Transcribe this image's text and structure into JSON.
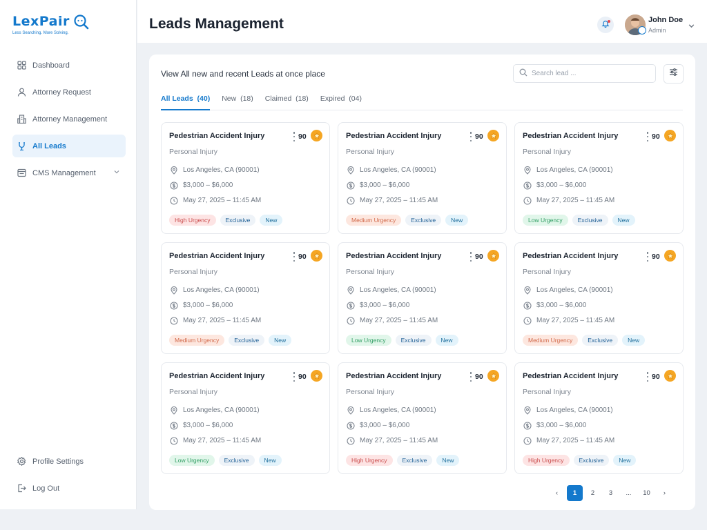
{
  "brand": {
    "name": "LexPair",
    "tagline": "Less Searching. More Solving."
  },
  "sidebar": {
    "items": [
      {
        "label": "Dashboard",
        "icon": "grid-icon"
      },
      {
        "label": "Attorney Request",
        "icon": "user-icon"
      },
      {
        "label": "Attorney Management",
        "icon": "building-icon"
      },
      {
        "label": "All Leads",
        "icon": "leads-icon",
        "active": true
      },
      {
        "label": "CMS Management",
        "icon": "cms-icon"
      }
    ],
    "bottom": [
      {
        "label": "Profile Settings",
        "icon": "gear-icon"
      },
      {
        "label": "Log Out",
        "icon": "logout-icon"
      }
    ]
  },
  "header": {
    "title": "Leads Management",
    "user": {
      "name": "John Doe",
      "role": "Admin"
    }
  },
  "main": {
    "subtitle": "View All new and recent Leads at once place",
    "search_placeholder": "Search lead ...",
    "tabs": [
      {
        "label": "All Leads",
        "count": "(40)"
      },
      {
        "label": "New",
        "count": "(18)"
      },
      {
        "label": "Claimed",
        "count": "(18)"
      },
      {
        "label": "Expired",
        "count": "(04)"
      }
    ]
  },
  "leads": [
    {
      "title": "Pedestrian Accident Injury",
      "score": "90",
      "category": "Personal Injury",
      "location": "Los Angeles, CA (90001)",
      "price": "$3,000 – $6,000",
      "date": "May 27, 2025 – 11:45 AM",
      "urgency": "High Urgency",
      "exclusive": "Exclusive",
      "status": "New"
    },
    {
      "title": "Pedestrian Accident Injury",
      "score": "90",
      "category": "Personal Injury",
      "location": "Los Angeles, CA (90001)",
      "price": "$3,000 – $6,000",
      "date": "May 27, 2025 – 11:45 AM",
      "urgency": "Medium Urgency",
      "exclusive": "Exclusive",
      "status": "New"
    },
    {
      "title": "Pedestrian Accident Injury",
      "score": "90",
      "category": "Personal Injury",
      "location": "Los Angeles, CA (90001)",
      "price": "$3,000 – $6,000",
      "date": "May 27, 2025 – 11:45 AM",
      "urgency": "Low Urgency",
      "exclusive": "Exclusive",
      "status": "New"
    },
    {
      "title": "Pedestrian Accident Injury",
      "score": "90",
      "category": "Personal Injury",
      "location": "Los Angeles, CA (90001)",
      "price": "$3,000 – $6,000",
      "date": "May 27, 2025 – 11:45 AM",
      "urgency": "Medium Urgency",
      "exclusive": "Exclusive",
      "status": "New"
    },
    {
      "title": "Pedestrian Accident Injury",
      "score": "90",
      "category": "Personal Injury",
      "location": "Los Angeles, CA (90001)",
      "price": "$3,000 – $6,000",
      "date": "May 27, 2025 – 11:45 AM",
      "urgency": "Low Urgency",
      "exclusive": "Exclusive",
      "status": "New"
    },
    {
      "title": "Pedestrian Accident Injury",
      "score": "90",
      "category": "Personal Injury",
      "location": "Los Angeles, CA (90001)",
      "price": "$3,000 – $6,000",
      "date": "May 27, 2025 – 11:45 AM",
      "urgency": "Medium Urgency",
      "exclusive": "Exclusive",
      "status": "New"
    },
    {
      "title": "Pedestrian Accident Injury",
      "score": "90",
      "category": "Personal Injury",
      "location": "Los Angeles, CA (90001)",
      "price": "$3,000 – $6,000",
      "date": "May 27, 2025 – 11:45 AM",
      "urgency": "Low Urgency",
      "exclusive": "Exclusive",
      "status": "New"
    },
    {
      "title": "Pedestrian Accident Injury",
      "score": "90",
      "category": "Personal Injury",
      "location": "Los Angeles, CA (90001)",
      "price": "$3,000 – $6,000",
      "date": "May 27, 2025 – 11:45 AM",
      "urgency": "High Urgency",
      "exclusive": "Exclusive",
      "status": "New"
    },
    {
      "title": "Pedestrian Accident Injury",
      "score": "90",
      "category": "Personal Injury",
      "location": "Los Angeles, CA (90001)",
      "price": "$3,000 – $6,000",
      "date": "May 27, 2025 – 11:45 AM",
      "urgency": "High Urgency",
      "exclusive": "Exclusive",
      "status": "New"
    }
  ],
  "urgency_colors": {
    "High Urgency": {
      "bg": "#fde4e4",
      "fg": "#c94a4a"
    },
    "Medium Urgency": {
      "bg": "#fde7df",
      "fg": "#d2694a"
    },
    "Low Urgency": {
      "bg": "#e1f6ea",
      "fg": "#2f9d62"
    }
  },
  "pagination": {
    "prev": "‹",
    "pages": [
      "1",
      "2",
      "3",
      "...",
      "10"
    ],
    "current": "1",
    "next": "›"
  },
  "colors": {
    "accent": "#1479cc",
    "star": "#f5a623"
  }
}
